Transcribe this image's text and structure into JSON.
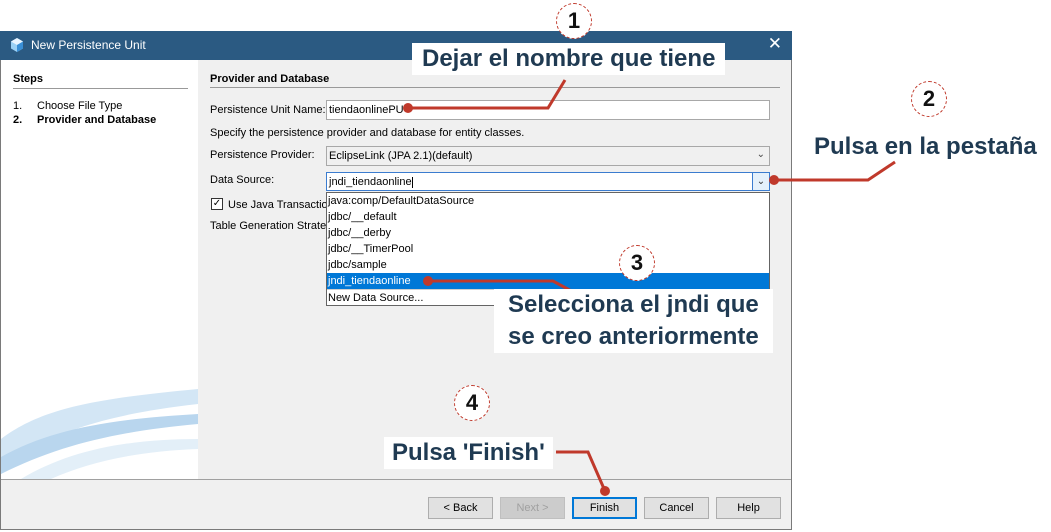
{
  "window": {
    "title": "New Persistence Unit",
    "close_glyph": "✕"
  },
  "steps": {
    "title": "Steps",
    "items": [
      {
        "num": "1.",
        "label": "Choose File Type"
      },
      {
        "num": "2.",
        "label": "Provider and Database"
      }
    ]
  },
  "main": {
    "title": "Provider and Database",
    "unit_name_label": "Persistence Unit Name:",
    "unit_name_value": "tiendaonlinePU",
    "hint": "Specify the persistence provider and database for entity classes.",
    "provider_label": "Persistence Provider:",
    "provider_value": "EclipseLink (JPA 2.1)(default)",
    "datasource_label": "Data Source:",
    "datasource_value": "jndi_tiendaonline",
    "jta_label": "Use Java Transactio",
    "jta_checked": "✓",
    "table_strategy_label": "Table Generation Strate",
    "datasource_options": [
      "java:comp/DefaultDataSource",
      "jdbc/__default",
      "jdbc/__derby",
      "jdbc/__TimerPool",
      "jdbc/sample",
      "jndi_tiendaonline",
      "New Data Source..."
    ],
    "selected_option": "jndi_tiendaonline"
  },
  "buttons": {
    "back": "< Back",
    "next": "Next >",
    "finish": "Finish",
    "cancel": "Cancel",
    "help": "Help"
  },
  "annotations": {
    "badge1": "1",
    "badge2": "2",
    "badge3": "3",
    "badge4": "4",
    "callout1": "Dejar el nombre que tiene",
    "callout2": "Pulsa en la pestaña",
    "callout3_line1": "Selecciona el jndi que",
    "callout3_line2": "se creo anteriormente",
    "callout4": "Pulsa 'Finish'"
  },
  "colors": {
    "titlebar": "#2b5a82",
    "selection": "#0078d7",
    "annotation_line": "#c0392b",
    "callout_text": "#1f3a52"
  }
}
